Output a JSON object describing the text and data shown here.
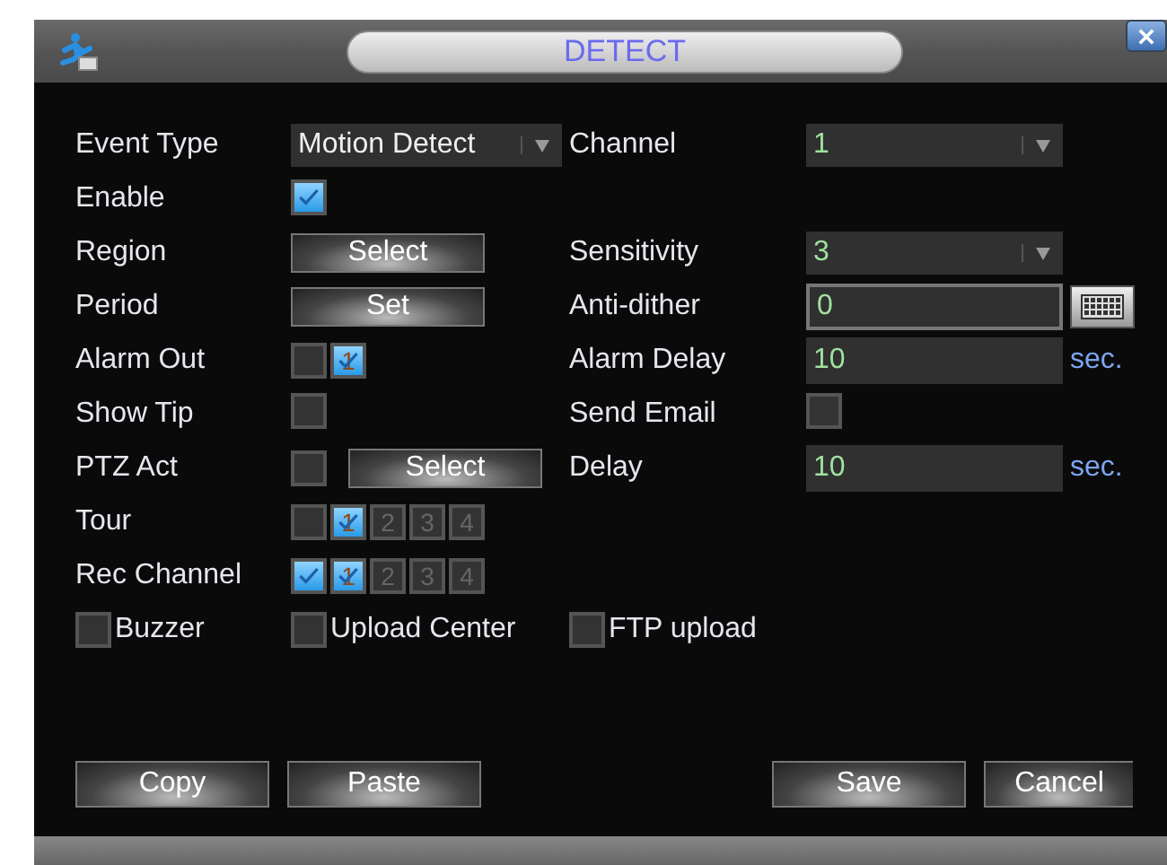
{
  "window": {
    "title": "DETECT"
  },
  "rows": [
    {
      "left": {
        "label": "Event Type",
        "kind": "dropdown",
        "value": "Motion Detect"
      },
      "right": {
        "label": "Channel",
        "kind": "dropdown",
        "value": "1"
      }
    },
    {
      "left": {
        "label": "Enable",
        "kind": "checkbox",
        "checked": true
      }
    },
    {
      "left": {
        "label": "Region",
        "kind": "button",
        "text": "Select"
      },
      "right": {
        "label": "Sensitivity",
        "kind": "dropdown",
        "value": "3"
      }
    },
    {
      "left": {
        "label": "Period",
        "kind": "button",
        "text": "Set"
      },
      "right": {
        "label": "Anti-dither",
        "kind": "keyboard_input",
        "value": "0"
      }
    },
    {
      "left": {
        "label": "Alarm Out",
        "kind": "channels",
        "all_checked": false,
        "channels": [
          {
            "label": "1",
            "checked": true,
            "disabled": false
          }
        ]
      },
      "right": {
        "label": "Alarm Delay",
        "kind": "input",
        "value": "10",
        "unit": "sec."
      }
    },
    {
      "left": {
        "label": "Show Tip",
        "kind": "checkbox",
        "checked": false
      },
      "right": {
        "label": "Send Email",
        "kind": "checkbox",
        "checked": false
      }
    },
    {
      "left": {
        "label": "PTZ Act",
        "kind": "checkbox_button",
        "checked": false,
        "text": "Select"
      },
      "right": {
        "label": "Delay",
        "kind": "input",
        "value": "10",
        "unit": "sec."
      }
    },
    {
      "left": {
        "label": "Tour",
        "kind": "channels",
        "all_checked": false,
        "channels": [
          {
            "label": "1",
            "checked": true,
            "disabled": false
          },
          {
            "label": "2",
            "checked": false,
            "disabled": true
          },
          {
            "label": "3",
            "checked": false,
            "disabled": true
          },
          {
            "label": "4",
            "checked": false,
            "disabled": true
          }
        ]
      }
    },
    {
      "left": {
        "label": "Rec Channel",
        "kind": "channels",
        "all_checked": true,
        "channels": [
          {
            "label": "1",
            "checked": true,
            "disabled": false
          },
          {
            "label": "2",
            "checked": false,
            "disabled": true
          },
          {
            "label": "3",
            "checked": false,
            "disabled": true
          },
          {
            "label": "4",
            "checked": false,
            "disabled": true
          }
        ]
      }
    }
  ],
  "options": [
    {
      "label": "Buzzer",
      "checked": false
    },
    {
      "label": "Upload Center",
      "checked": false
    },
    {
      "label": "FTP upload",
      "checked": false
    }
  ],
  "buttons": [
    "Copy",
    "Paste",
    "Save",
    "Cancel"
  ]
}
